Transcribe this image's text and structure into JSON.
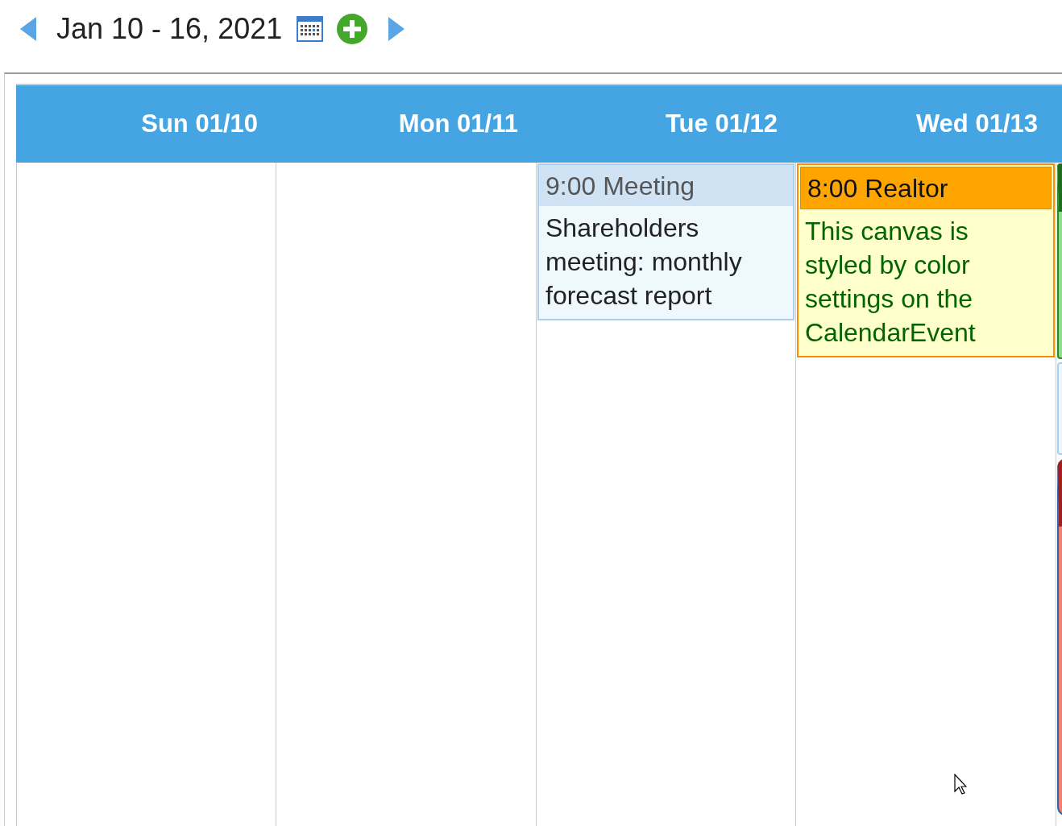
{
  "toolbar": {
    "date_range": "Jan 10 - 16, 2021"
  },
  "days": [
    {
      "header": "Sun 01/10"
    },
    {
      "header": "Mon 01/11"
    },
    {
      "header": "Tue 01/12",
      "events": [
        {
          "title": "9:00 Meeting",
          "description": "Shareholders meeting: monthly forecast report",
          "kind": "default"
        }
      ]
    },
    {
      "header": "Wed 01/13",
      "events": [
        {
          "title": "8:00 Realtor",
          "description": "This canvas is styled by color settings on the CalendarEvent",
          "kind": "custom"
        }
      ]
    }
  ],
  "partial_events": [
    {
      "color": "#8fdc8f"
    },
    {
      "color": "#eef6fe"
    },
    {
      "color": "#f08070"
    }
  ]
}
